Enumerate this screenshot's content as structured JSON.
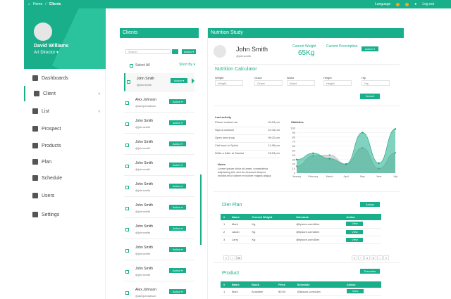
{
  "topbar": {
    "home": "Home",
    "sep": "/",
    "current": "Clients",
    "language": "Language",
    "logout": "Log out"
  },
  "sidebar": {
    "user_name": "David Williams",
    "user_role": "Art Director",
    "items": [
      {
        "label": "Dashboards"
      },
      {
        "label": "Client"
      },
      {
        "label": "List"
      },
      {
        "label": "Prospect"
      },
      {
        "label": "Products"
      },
      {
        "label": "Plan"
      },
      {
        "label": "Schedule"
      },
      {
        "label": "Users"
      },
      {
        "label": "Settings"
      }
    ]
  },
  "clients": {
    "title": "Clients",
    "search_placeholder": "Search",
    "action_label": "Action ▾",
    "select_all": "Select All",
    "sort_by": "Short By ▾",
    "rows": [
      {
        "name": "John Smith",
        "user": "@johnsmith"
      },
      {
        "name": "Alex Johnson",
        "user": "@alexjohnathan"
      },
      {
        "name": "John Smith",
        "user": "@johnsmith"
      },
      {
        "name": "John Smith",
        "user": "@johnsmith"
      },
      {
        "name": "John Smith",
        "user": "@johnsmith"
      },
      {
        "name": "John Smith",
        "user": "@johnsmith"
      },
      {
        "name": "John Smith",
        "user": "@johnsmith"
      },
      {
        "name": "John Smith",
        "user": "@johnsmith"
      },
      {
        "name": "John Smith",
        "user": "@johnsmith"
      },
      {
        "name": "John Smith",
        "user": "@johnsmith"
      },
      {
        "name": "Alex Johnson",
        "user": "@alexjohnathan"
      }
    ]
  },
  "nutrition": {
    "title": "Nutrition Study",
    "client_name": "John Smith",
    "client_user": "@johnsmith",
    "current_weight_label": "Current Weight",
    "current_weight": "65Kg",
    "current_prescription_label": "Current Prescription",
    "action_label": "Action ▾",
    "calc_title": "Nutrition Calculator",
    "fields": [
      {
        "label": "Weight",
        "placeholder": "Weight"
      },
      {
        "label": "Grace",
        "placeholder": "Grace"
      },
      {
        "label": "Waist",
        "placeholder": "Waist"
      },
      {
        "label": "Height",
        "placeholder": "Height"
      },
      {
        "label": "Hip",
        "placeholder": "Hip"
      }
    ],
    "submit": "Submit",
    "last_activity_title": "Last activity",
    "activities": [
      {
        "text": "Phone contact me",
        "time": "09:03 pm"
      },
      {
        "text": "Sign a contract",
        "time": "10:15 pm"
      },
      {
        "text": "Open new shop",
        "time": "09:22 pm"
      },
      {
        "text": "Call back to Sylvia",
        "time": "11:06 pm"
      },
      {
        "text": "Write a letter to Sandra",
        "time": "15:03 pm"
      }
    ],
    "notes_title": "Notes",
    "notes_text": "Lorem ipsum dolor sit amet, consectetur adipiscing elit, sed do eiusmod tempor incididunt ut labore et dolore magna aliqua.",
    "stats_title": "Statistics",
    "diet_title": "Diet Plan",
    "assign": "Assign",
    "diet_headers": [
      "#",
      "Name",
      "Current Weight",
      "Schedule",
      "Action"
    ],
    "diet_rows": [
      {
        "n": "1",
        "name": "Mark",
        "w": "Kg",
        "s": "@lipsum.com/Alex"
      },
      {
        "n": "2",
        "name": "Jacob",
        "w": "Kg",
        "s": "@lipsum.com/Alex"
      },
      {
        "n": "3",
        "name": "Larry",
        "w": "Kg",
        "s": "@lipsum.com/Alex"
      }
    ],
    "view": "View",
    "pager_left": [
      "«",
      "‹",
      "50"
    ],
    "pager_right": [
      "«",
      "‹",
      "1",
      "2",
      "›",
      "»"
    ],
    "product_title": "Product",
    "prescribe": "Prescribe",
    "prod_headers": [
      "#",
      "Name",
      "Stock",
      "Price",
      "Schedule",
      "Action"
    ],
    "prod_rows": [
      {
        "n": "1",
        "name": "Mark",
        "stock": "Available",
        "price": "$0.00",
        "s": "@lipsum.com/Alex"
      }
    ]
  },
  "chart_data": {
    "type": "area",
    "title": "Statistics",
    "categories": [
      "January",
      "February",
      "March",
      "April",
      "May",
      "June",
      "July"
    ],
    "ylim": [
      0,
      100
    ],
    "yticks": [
      0,
      10,
      20,
      30,
      40,
      50,
      60,
      70,
      80,
      90,
      100
    ],
    "series": [
      {
        "values": [
          30,
          44,
          32,
          20,
          90,
          22,
          98
        ]
      },
      {
        "values": [
          15,
          38,
          40,
          20,
          56,
          10,
          45
        ]
      }
    ],
    "colors": [
      "#1aaf8b",
      "#c7c7c7"
    ]
  }
}
